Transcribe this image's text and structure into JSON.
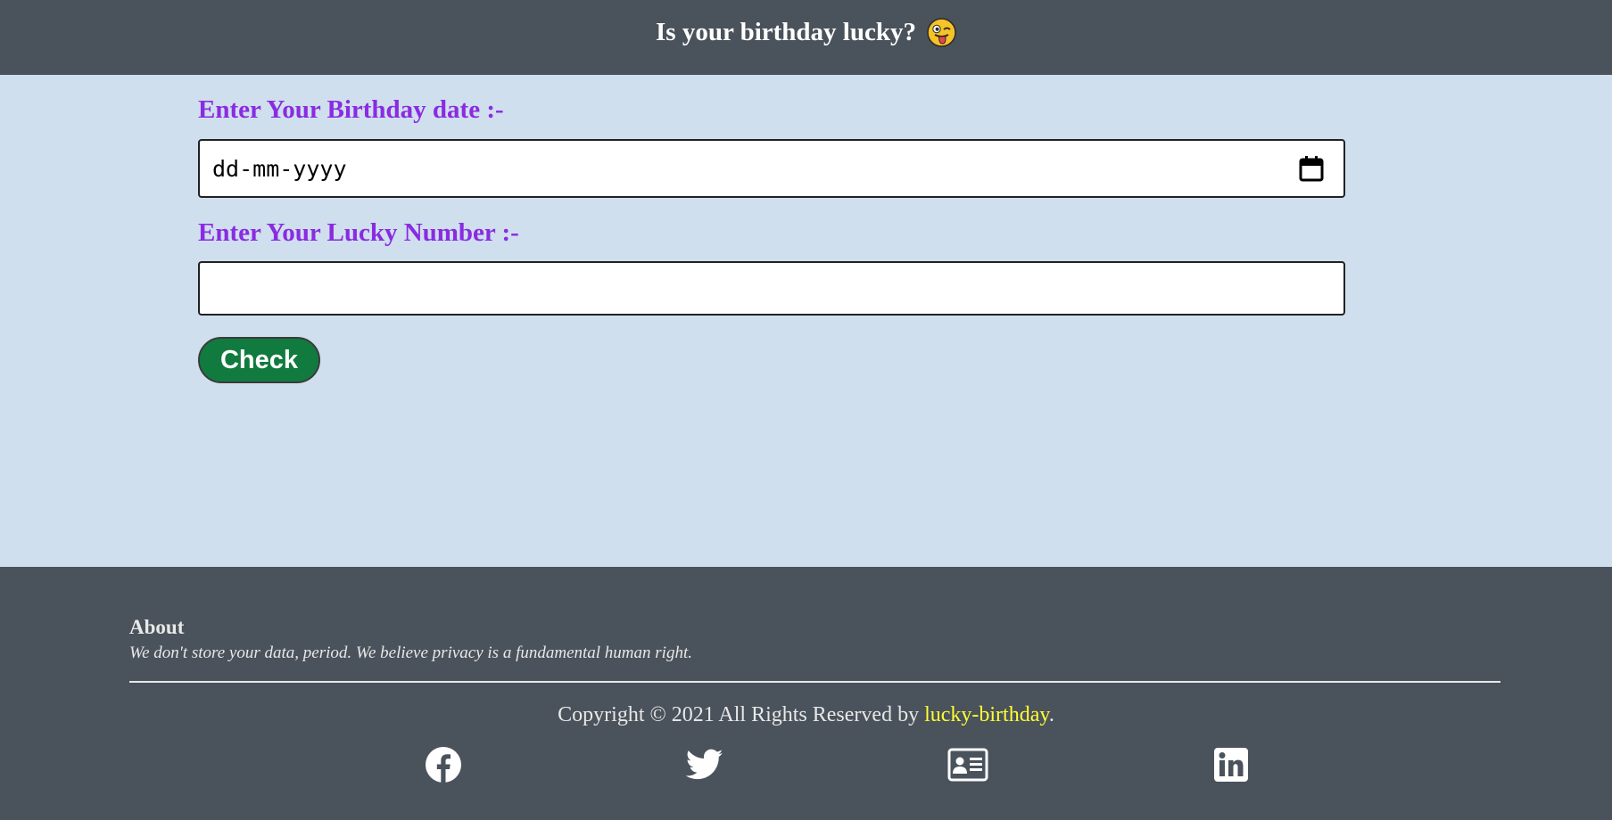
{
  "header": {
    "title": "Is your birthday lucky?",
    "emoji": "winking-tongue-emoji"
  },
  "form": {
    "birthday_label": "Enter Your Birthday date :-",
    "birthday_placeholder": "dd-mm-yyyy",
    "lucky_number_label": "Enter Your Lucky Number :-",
    "lucky_number_value": "",
    "check_label": "Check"
  },
  "footer": {
    "about_title": "About",
    "about_text": "We don't store your data, period. We believe privacy is a fundamental human right.",
    "copyright_prefix": "Copyright © 2021 All Rights Reserved by ",
    "brand": "lucky-birthday",
    "copyright_suffix": ".",
    "social": [
      {
        "icon": "facebook-icon"
      },
      {
        "icon": "twitter-icon"
      },
      {
        "icon": "portfolio-card-icon"
      },
      {
        "icon": "linkedin-icon"
      }
    ]
  },
  "colors": {
    "header_bg": "#4a525b",
    "main_bg": "#cfdfee",
    "label": "#8a2be2",
    "button": "#117a3e",
    "brand": "#ffff33"
  }
}
